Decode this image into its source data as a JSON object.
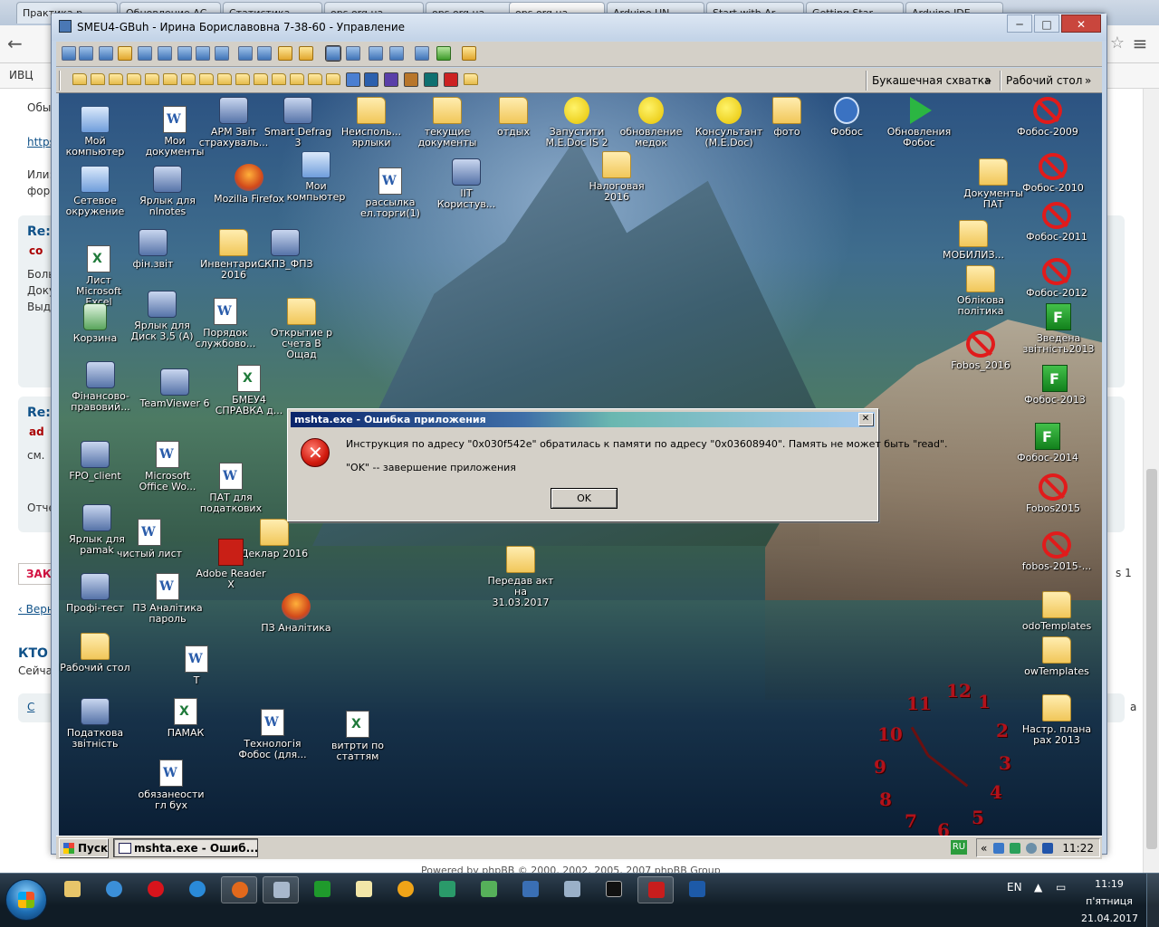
{
  "browser": {
    "tabs": [
      {
        "label": "Практика.р",
        "active": false
      },
      {
        "label": "Обновление АС",
        "active": false
      },
      {
        "label": "Статистика",
        "active": false
      },
      {
        "label": "ops.org.ua",
        "active": false
      },
      {
        "label": "ops.org.ua",
        "active": false
      },
      {
        "label": "ops.org.ua",
        "active": true
      },
      {
        "label": "Arduino UN",
        "active": false
      },
      {
        "label": "Start with Ar",
        "active": false
      },
      {
        "label": "Getting Star",
        "active": false
      },
      {
        "label": "Arduino IDE",
        "active": false
      }
    ],
    "bookmark_first": "ИВЦ",
    "page_texts": [
      {
        "text": "Обы",
        "style": ""
      },
      {
        "text": "https",
        "style": "link"
      },
      {
        "text": "Или:",
        "style": ""
      },
      {
        "text": "форм",
        "style": ""
      },
      {
        "text": "Re:",
        "style": "b"
      },
      {
        "text": "co",
        "style": "red"
      },
      {
        "text": "Боль",
        "style": ""
      },
      {
        "text": "Доку",
        "style": ""
      },
      {
        "text": "Выдо",
        "style": ""
      },
      {
        "text": "Re:",
        "style": "b"
      },
      {
        "text": "ad",
        "style": "red"
      },
      {
        "text": "см.",
        "style": ""
      },
      {
        "text": "Отче",
        "style": ""
      },
      {
        "text": "‹ Верн",
        "style": "link"
      },
      {
        "text": "КТО СЕ",
        "style": "b"
      },
      {
        "text": "Сейча",
        "style": ""
      },
      {
        "text": "С",
        "style": "link"
      },
      {
        "text": "s 1",
        "style": ""
      },
      {
        "text": "a",
        "style": ""
      }
    ],
    "reply_button": "ЗАК",
    "footer": "Powered by phpBB © 2000, 2002, 2005, 2007 phpBB Group"
  },
  "rdp": {
    "title": "SMEU4-GBuh - Ирина Бориславовна 7-38-60 - Управление",
    "min_label": "─",
    "max_label": "□",
    "close_label": "✕",
    "quick_labels": {
      "link1": "Букашечная схватка",
      "link2": "Рабочий стол"
    },
    "chevron": "»"
  },
  "desktop": {
    "icons": [
      {
        "label": "Мой компьютер",
        "kind": "pc"
      },
      {
        "label": "Мои документы",
        "kind": "doc"
      },
      {
        "label": "АРМ Звіт страхуваль...",
        "kind": "gen"
      },
      {
        "label": "Smart Defrag 3",
        "kind": "gen"
      },
      {
        "label": "Неисполь... ярлыки",
        "kind": "folder"
      },
      {
        "label": "текущие документы",
        "kind": "folder"
      },
      {
        "label": "отдых",
        "kind": "folder"
      },
      {
        "label": "Запустити M.E.Doc IS 2",
        "kind": "bulbs"
      },
      {
        "label": "обновление медок",
        "kind": "bulbs"
      },
      {
        "label": "Консультант (M.E.Doc)",
        "kind": "bulbs"
      },
      {
        "label": "фото",
        "kind": "folder"
      },
      {
        "label": "Фобос",
        "kind": "power"
      },
      {
        "label": "Обновления Фобос",
        "kind": "green-arrow"
      },
      {
        "label": "Фобос-2009",
        "kind": "nope"
      },
      {
        "label": "Сетевое окружение",
        "kind": "pc"
      },
      {
        "label": "Ярлык для nlnotes",
        "kind": "gen"
      },
      {
        "label": "Mozilla Firefox",
        "kind": "ff"
      },
      {
        "label": "Мои компьютер",
        "kind": "pc"
      },
      {
        "label": "рассылка ел.торги(1)",
        "kind": "doc"
      },
      {
        "label": "ІІТ Користув...",
        "kind": "gen"
      },
      {
        "label": "Налоговая 2016",
        "kind": "folder"
      },
      {
        "label": "Документы ПАТ",
        "kind": "folder"
      },
      {
        "label": "Фобос-2010",
        "kind": "nope"
      },
      {
        "label": "Лист Microsoft Excel",
        "kind": "xls"
      },
      {
        "label": "фін.звіт",
        "kind": "gen"
      },
      {
        "label": "Инвентари... 2016",
        "kind": "folder"
      },
      {
        "label": "СКПЗ_ФПЗ",
        "kind": "gen"
      },
      {
        "label": "МОБИЛИЗ...",
        "kind": "folder"
      },
      {
        "label": "Фобос-2011",
        "kind": "nope"
      },
      {
        "label": "Корзина",
        "kind": "recycle"
      },
      {
        "label": "Ярлык для Диск 3,5 (A)",
        "kind": "gen"
      },
      {
        "label": "Порядок службово...",
        "kind": "doc"
      },
      {
        "label": "Открытие р счета В Ощад",
        "kind": "folder"
      },
      {
        "label": "Облікова політика",
        "kind": "folder"
      },
      {
        "label": "Фобос-2012",
        "kind": "nope"
      },
      {
        "label": "Зведена звітність2013",
        "kind": "fgreen"
      },
      {
        "label": "Фінансово-правовий...",
        "kind": "gen"
      },
      {
        "label": "TeamViewer 6",
        "kind": "gen"
      },
      {
        "label": "БМЕУ4 СПРАВКА д...",
        "kind": "xls"
      },
      {
        "label": "Fobos_2016",
        "kind": "nope"
      },
      {
        "label": "Фобос-2013",
        "kind": "fgreen"
      },
      {
        "label": "FPO_client",
        "kind": "gen"
      },
      {
        "label": "Microsoft Office Wo...",
        "kind": "doc"
      },
      {
        "label": "ПАТ для податкових",
        "kind": "doc"
      },
      {
        "label": "Фобос-2014",
        "kind": "fgreen"
      },
      {
        "label": "Fobos2015",
        "kind": "nope"
      },
      {
        "label": "Ярлык для pamak",
        "kind": "gen"
      },
      {
        "label": "чистый лист",
        "kind": "doc"
      },
      {
        "label": "Деклар 2016",
        "kind": "folder"
      },
      {
        "label": "fobos-2015-...",
        "kind": "nope"
      },
      {
        "label": "Профі-тест",
        "kind": "gen"
      },
      {
        "label": "ПЗ Аналітика пароль",
        "kind": "doc"
      },
      {
        "label": "Adobe Reader X",
        "kind": "pdf"
      },
      {
        "label": "Передав акт на 31.03.2017",
        "kind": "folder"
      },
      {
        "label": "odoTemplates",
        "kind": "folder"
      },
      {
        "label": "ПЗ Аналітика",
        "kind": "ff"
      },
      {
        "label": "Рабочий стол",
        "kind": "folder"
      },
      {
        "label": "Т",
        "kind": "doc"
      },
      {
        "label": "owTemplates",
        "kind": "folder"
      },
      {
        "label": "Податкова звітність",
        "kind": "gen"
      },
      {
        "label": "ПАМАК",
        "kind": "xls"
      },
      {
        "label": "Технологія Фобос (для...",
        "kind": "doc"
      },
      {
        "label": "витрти по статтям",
        "kind": "xls"
      },
      {
        "label": "Настр. плана рах 2013",
        "kind": "folder"
      },
      {
        "label": "обязанеости гл бух",
        "kind": "doc"
      }
    ],
    "clock_numbers": [
      "12",
      "1",
      "2",
      "3",
      "4",
      "5",
      "6",
      "7",
      "8",
      "9",
      "10",
      "11"
    ]
  },
  "dialog": {
    "title": "mshta.exe - Ошибка приложения",
    "close_label": "✕",
    "message": "Инструкция по адресу \"0x030f542e\" обратилась к памяти по адресу \"0x03608940\". Память не может быть \"read\".",
    "message2": "\"OK\" -- завершение приложения",
    "ok_label": "OK"
  },
  "rdp_taskbar": {
    "start_label": "Пуск",
    "task_label": "mshta.exe - Ошиб...",
    "lang": "RU",
    "tray_arrow": "«",
    "time": "11:22"
  },
  "win7_taskbar": {
    "lang": "EN",
    "time": "11:19",
    "day": "п'ятниця",
    "date": "21.04.2017",
    "tray_arrow": "▲"
  },
  "colors": {
    "dialog_title": "#0a246a",
    "error_red": "#d11a0e",
    "win7_bar": "#1a2a38"
  }
}
